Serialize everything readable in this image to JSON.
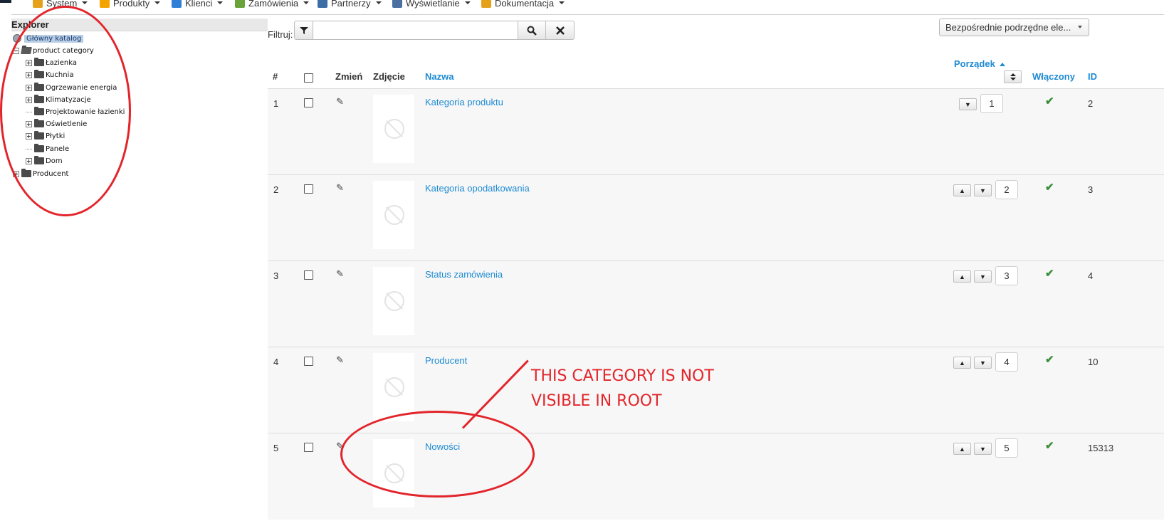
{
  "menu": [
    {
      "label": "System",
      "icon": "tools-icon",
      "color": "#e6a11a"
    },
    {
      "label": "Produkty",
      "icon": "box-icon",
      "color": "#f3a400"
    },
    {
      "label": "Klienci",
      "icon": "users-icon",
      "color": "#2f7fd6"
    },
    {
      "label": "Zamówienia",
      "icon": "orders-icon",
      "color": "#69a33a"
    },
    {
      "label": "Partnerzy",
      "icon": "partners-icon",
      "color": "#3a6ea5"
    },
    {
      "label": "Wyświetlanie",
      "icon": "display-icon",
      "color": "#4a6fa0"
    },
    {
      "label": "Dokumentacja",
      "icon": "docs-icon",
      "color": "#e6a11a"
    }
  ],
  "explorer": {
    "title": "Explorer",
    "root": "Główny katalog",
    "nodes": [
      {
        "label": "product category"
      },
      {
        "label": "Łazienka"
      },
      {
        "label": "Kuchnia"
      },
      {
        "label": "Ogrzewanie energia"
      },
      {
        "label": "Klimatyzacje"
      },
      {
        "label": "Projektowanie łazienki"
      },
      {
        "label": "Oświetlenie"
      },
      {
        "label": "Płytki"
      },
      {
        "label": "Panele"
      },
      {
        "label": "Dom"
      },
      {
        "label": "Producent"
      }
    ]
  },
  "filter": {
    "label": "Filtruj:",
    "value": "",
    "view_select": "Bezpośrednie podrzędne ele..."
  },
  "table": {
    "headers": {
      "num": "#",
      "edit": "Zmień",
      "photo": "Zdjęcie",
      "name": "Nazwa",
      "order": "Porządek",
      "enabled": "Włączony",
      "id": "ID"
    },
    "rows": [
      {
        "num": "1",
        "name": "Kategoria produktu",
        "order": "1",
        "id": "2"
      },
      {
        "num": "2",
        "name": "Kategoria opodatkowania",
        "order": "2",
        "id": "3"
      },
      {
        "num": "3",
        "name": "Status zamówienia",
        "order": "3",
        "id": "4"
      },
      {
        "num": "4",
        "name": "Producent",
        "order": "4",
        "id": "10"
      },
      {
        "num": "5",
        "name": "Nowości",
        "order": "5",
        "id": "15313"
      }
    ]
  },
  "annotation": {
    "line1": "THIS CATEGORY IS NOT",
    "line2": "VISIBLE IN ROOT",
    "color": "#e2252b"
  }
}
